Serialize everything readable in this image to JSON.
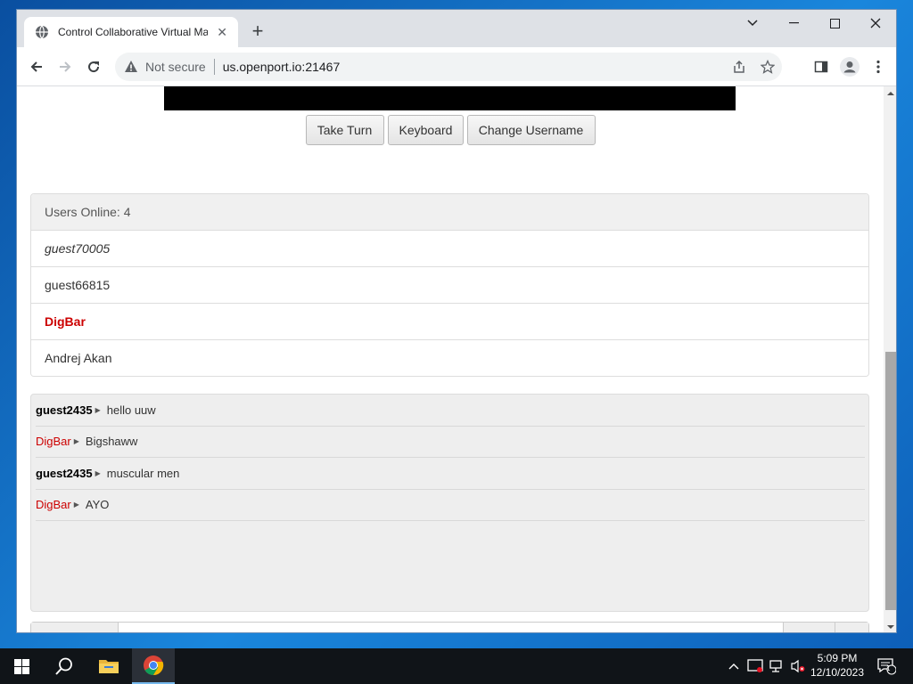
{
  "browser": {
    "tab_title": "Control Collaborative Virtual Ma",
    "new_tab_label": "+",
    "security_label": "Not secure",
    "url": "us.openport.io:21467"
  },
  "vm": {
    "buttons": {
      "take_turn": "Take Turn",
      "keyboard": "Keyboard",
      "change_username": "Change Username"
    }
  },
  "users_panel": {
    "header": "Users Online: 4",
    "users": [
      {
        "name": "guest70005",
        "style": "italic"
      },
      {
        "name": "guest66815",
        "style": "normal"
      },
      {
        "name": "DigBar",
        "style": "admin"
      },
      {
        "name": "Andrej Akan",
        "style": "normal"
      }
    ]
  },
  "chat": {
    "messages": [
      {
        "user": "guest2435",
        "text": "hello uuw",
        "admin": false
      },
      {
        "user": "DigBar",
        "text": "Bigshaww",
        "admin": true
      },
      {
        "user": "guest2435",
        "text": "muscular men",
        "admin": false
      },
      {
        "user": "DigBar",
        "text": "AYO",
        "admin": true
      }
    ]
  },
  "taskbar": {
    "time": "5:09 PM",
    "date": "12/10/2023",
    "notification_count": "1"
  },
  "colors": {
    "admin_red": "#cc0000",
    "taskbar_bg": "#101418",
    "tab_strip": "#dee1e6"
  }
}
